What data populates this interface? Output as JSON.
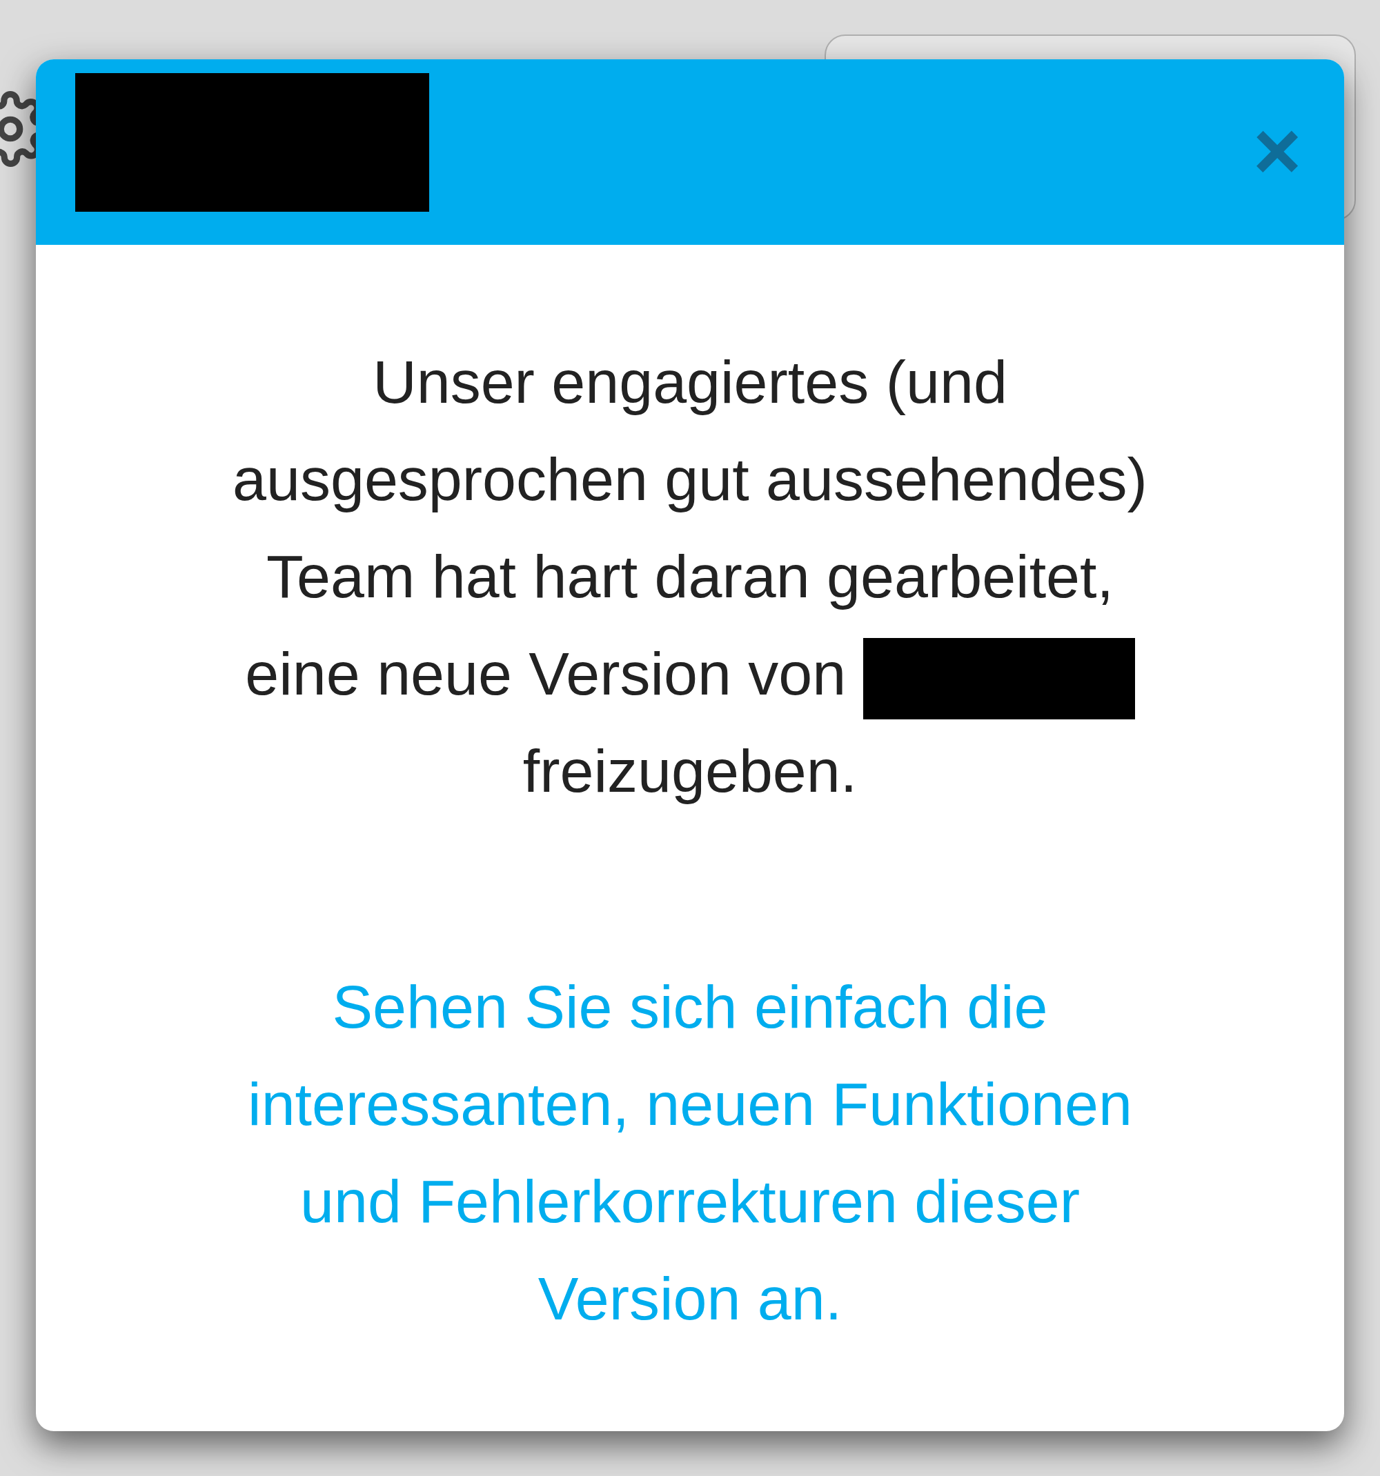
{
  "dialog": {
    "title_redacted": true,
    "close": "×",
    "message": "Unser engagiertes (und ausgesprochen gut aussehendes) Team hat hart daran gearbeitet, eine neue Version von",
    "message_redacted": true,
    "message_end": "freizugeben.",
    "link": "Sehen Sie sich einfach die interessanten, neuen Funktionen und Fehlerkorrekturen dieser Version an."
  }
}
